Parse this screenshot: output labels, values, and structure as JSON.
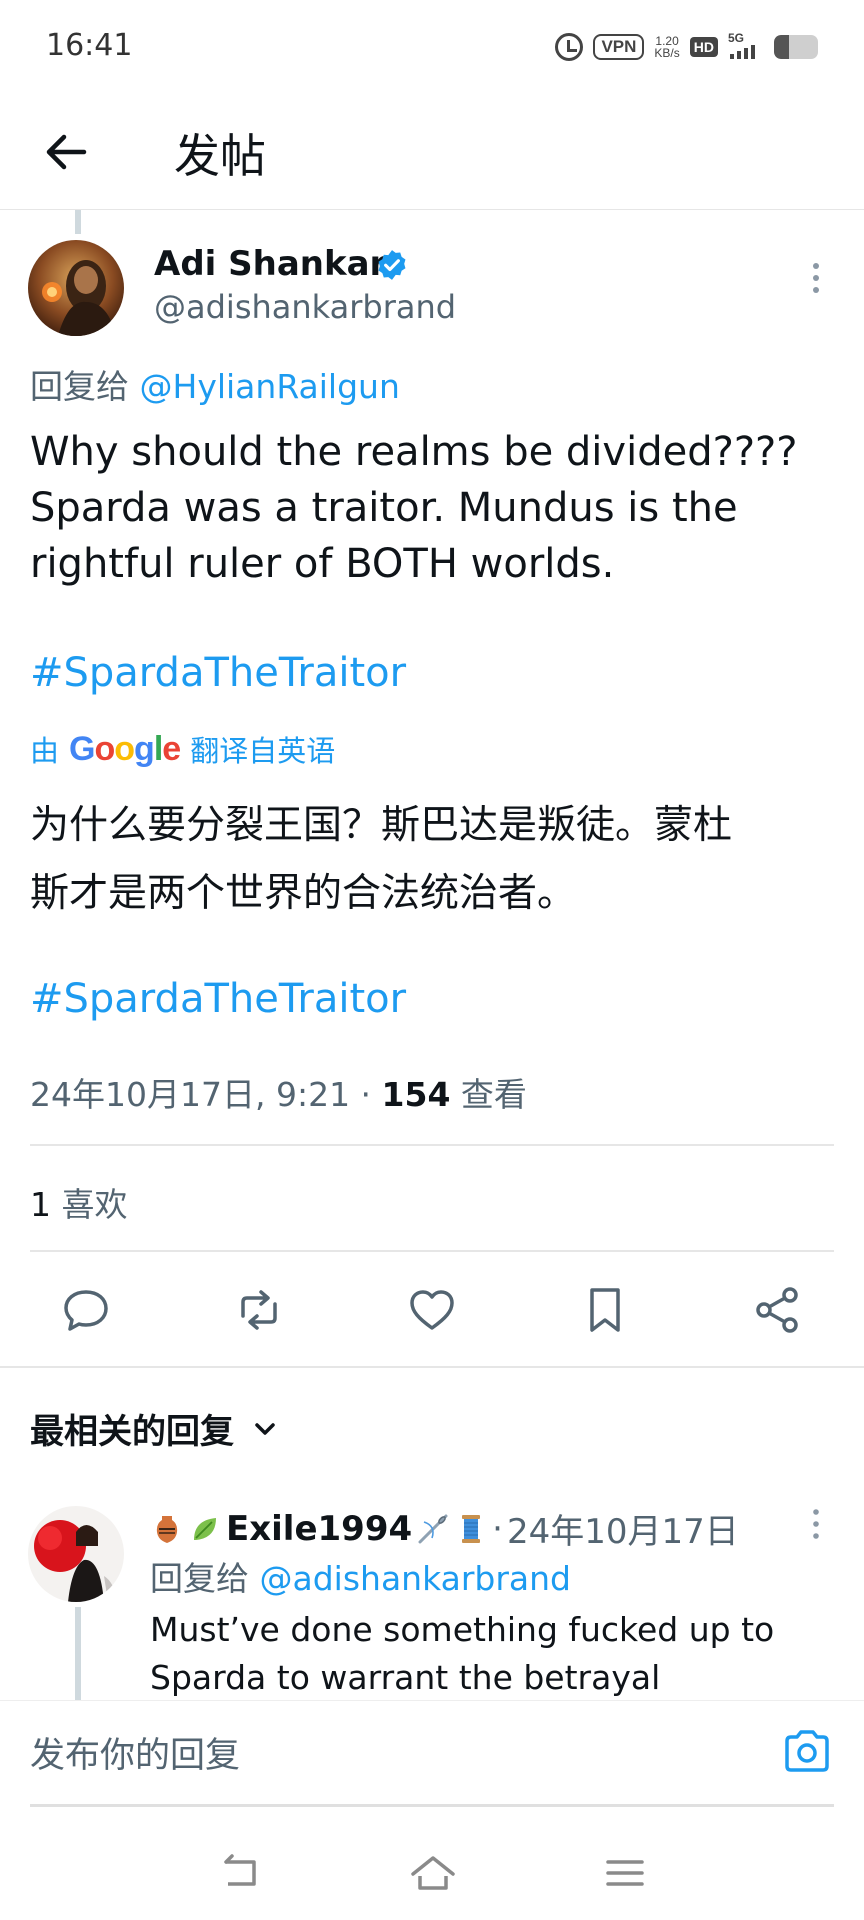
{
  "status_bar": {
    "time": "16:41",
    "vpn_label": "VPN",
    "speed_value": "1.20",
    "speed_unit": "KB/s",
    "hd_label": "HD",
    "network_label": "5G",
    "battery_level": 0.35
  },
  "header": {
    "title": "发帖"
  },
  "tweet": {
    "author_name": "Adi Shankar",
    "author_handle": "@adishankarbrand",
    "reply_prefix": "回复给",
    "reply_mention": "@HylianRailgun",
    "text_lines": [
      "Why should the realms be divided????",
      "Sparda was a traitor. Mundus is the",
      "rightful ruler of BOTH worlds."
    ],
    "hashtag": "#SpardaTheTraitor",
    "translation_prefix": "由",
    "translation_brand": "Google",
    "translation_suffix": "翻译自英语",
    "translated_lines": [
      "为什么要分裂王国？斯巴达是叛徒。蒙杜",
      "斯才是两个世界的合法统治者。"
    ],
    "translated_hashtag": "#SpardaTheTraitor",
    "timestamp": "24年10月17日, 9:21 · ",
    "views_count": "154",
    "views_label": " 查看",
    "likes_count": "1",
    "likes_label": " 喜欢"
  },
  "actions": {
    "icons": [
      "reply-icon",
      "retweet-icon",
      "like-icon",
      "bookmark-icon",
      "share-icon"
    ]
  },
  "replies_section": {
    "sort_label": "最相关的回复",
    "reply": {
      "name": "Exile1994",
      "emoji_before": [
        "amphora-icon",
        "leaf-icon"
      ],
      "emoji_after": [
        "needle-icon",
        "thread-spool-icon"
      ],
      "separator": " · ",
      "date": "24年10月17日",
      "reply_prefix": "回复给",
      "reply_mention": "@adishankarbrand",
      "body_lines": [
        "Must’ve done something fucked up to",
        "Sparda to warrant the betrayal"
      ]
    }
  },
  "compose": {
    "placeholder": "发布你的回复"
  },
  "colors": {
    "link_blue": "#1d9bf0",
    "text_primary": "#0f1419",
    "text_secondary": "#536471"
  }
}
